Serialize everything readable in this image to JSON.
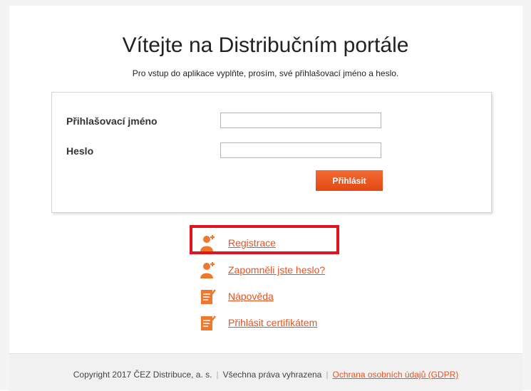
{
  "header": {
    "title": "Vítejte na Distribučním portále",
    "subtitle": "Pro vstup do aplikace vyplňte, prosím, své přihlašovací jméno a heslo."
  },
  "login_form": {
    "username_label": "Přihlašovací jméno",
    "username_value": "",
    "password_label": "Heslo",
    "password_value": "",
    "submit_label": "Přihlásit"
  },
  "links": [
    {
      "label": "Registrace",
      "icon": "user-add-icon"
    },
    {
      "label": "Zapomněli jste heslo?",
      "icon": "user-add-icon"
    },
    {
      "label": "Nápověda",
      "icon": "document-edit-icon"
    },
    {
      "label": "Přihlásit certifikátem",
      "icon": "document-edit-icon"
    }
  ],
  "footer": {
    "copyright": "Copyright 2017 ČEZ Distribuce, a. s.",
    "separator": "|",
    "rights": "Všechna práva vyhrazena",
    "privacy_link": "Ochrana osobních údajů (GDPR)"
  },
  "colors": {
    "accent": "#e8521e",
    "highlight": "#e0141e",
    "footer_bg": "#f1f1f1"
  }
}
